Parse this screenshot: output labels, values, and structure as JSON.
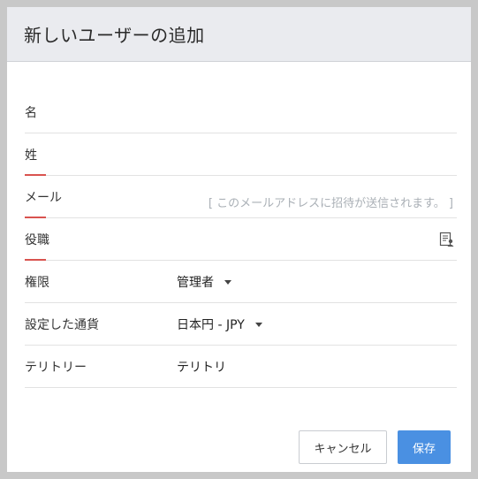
{
  "dialog": {
    "title": "新しいユーザーの追加"
  },
  "fields": {
    "first_name": {
      "label": "名",
      "value": ""
    },
    "last_name": {
      "label": "姓",
      "value": ""
    },
    "email": {
      "label": "メール",
      "hint": "[ このメールアドレスに招待が送信されます。 ]"
    },
    "job_title": {
      "label": "役職",
      "icon": "contact-card-icon"
    },
    "role": {
      "label": "権限",
      "value": "管理者"
    },
    "currency": {
      "label": "設定した通貨",
      "value": "日本円 - JPY"
    },
    "territory": {
      "label": "テリトリー",
      "value": "テリトリ"
    }
  },
  "buttons": {
    "cancel": "キャンセル",
    "save": "保存"
  },
  "colors": {
    "accent": "#4a90e2",
    "required": "#d9534f",
    "header_bg": "#eaebef"
  }
}
